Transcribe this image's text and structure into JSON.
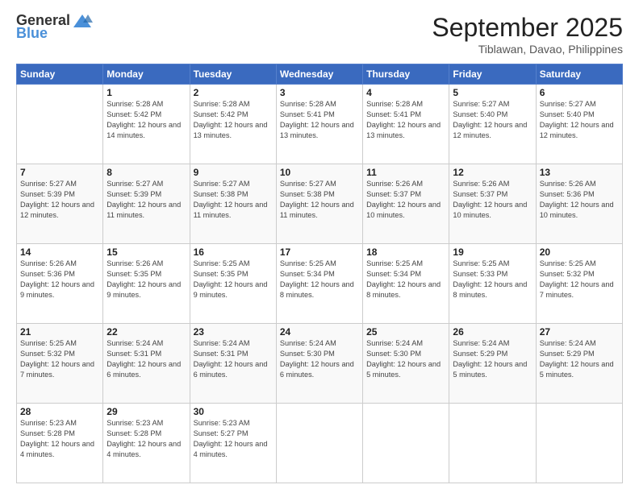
{
  "logo": {
    "general": "General",
    "blue": "Blue"
  },
  "title": "September 2025",
  "location": "Tiblawan, Davao, Philippines",
  "weekdays": [
    "Sunday",
    "Monday",
    "Tuesday",
    "Wednesday",
    "Thursday",
    "Friday",
    "Saturday"
  ],
  "weeks": [
    [
      {
        "day": "",
        "sunrise": "",
        "sunset": "",
        "daylight": ""
      },
      {
        "day": "1",
        "sunrise": "Sunrise: 5:28 AM",
        "sunset": "Sunset: 5:42 PM",
        "daylight": "Daylight: 12 hours and 14 minutes."
      },
      {
        "day": "2",
        "sunrise": "Sunrise: 5:28 AM",
        "sunset": "Sunset: 5:42 PM",
        "daylight": "Daylight: 12 hours and 13 minutes."
      },
      {
        "day": "3",
        "sunrise": "Sunrise: 5:28 AM",
        "sunset": "Sunset: 5:41 PM",
        "daylight": "Daylight: 12 hours and 13 minutes."
      },
      {
        "day": "4",
        "sunrise": "Sunrise: 5:28 AM",
        "sunset": "Sunset: 5:41 PM",
        "daylight": "Daylight: 12 hours and 13 minutes."
      },
      {
        "day": "5",
        "sunrise": "Sunrise: 5:27 AM",
        "sunset": "Sunset: 5:40 PM",
        "daylight": "Daylight: 12 hours and 12 minutes."
      },
      {
        "day": "6",
        "sunrise": "Sunrise: 5:27 AM",
        "sunset": "Sunset: 5:40 PM",
        "daylight": "Daylight: 12 hours and 12 minutes."
      }
    ],
    [
      {
        "day": "7",
        "sunrise": "Sunrise: 5:27 AM",
        "sunset": "Sunset: 5:39 PM",
        "daylight": "Daylight: 12 hours and 12 minutes."
      },
      {
        "day": "8",
        "sunrise": "Sunrise: 5:27 AM",
        "sunset": "Sunset: 5:39 PM",
        "daylight": "Daylight: 12 hours and 11 minutes."
      },
      {
        "day": "9",
        "sunrise": "Sunrise: 5:27 AM",
        "sunset": "Sunset: 5:38 PM",
        "daylight": "Daylight: 12 hours and 11 minutes."
      },
      {
        "day": "10",
        "sunrise": "Sunrise: 5:27 AM",
        "sunset": "Sunset: 5:38 PM",
        "daylight": "Daylight: 12 hours and 11 minutes."
      },
      {
        "day": "11",
        "sunrise": "Sunrise: 5:26 AM",
        "sunset": "Sunset: 5:37 PM",
        "daylight": "Daylight: 12 hours and 10 minutes."
      },
      {
        "day": "12",
        "sunrise": "Sunrise: 5:26 AM",
        "sunset": "Sunset: 5:37 PM",
        "daylight": "Daylight: 12 hours and 10 minutes."
      },
      {
        "day": "13",
        "sunrise": "Sunrise: 5:26 AM",
        "sunset": "Sunset: 5:36 PM",
        "daylight": "Daylight: 12 hours and 10 minutes."
      }
    ],
    [
      {
        "day": "14",
        "sunrise": "Sunrise: 5:26 AM",
        "sunset": "Sunset: 5:36 PM",
        "daylight": "Daylight: 12 hours and 9 minutes."
      },
      {
        "day": "15",
        "sunrise": "Sunrise: 5:26 AM",
        "sunset": "Sunset: 5:35 PM",
        "daylight": "Daylight: 12 hours and 9 minutes."
      },
      {
        "day": "16",
        "sunrise": "Sunrise: 5:25 AM",
        "sunset": "Sunset: 5:35 PM",
        "daylight": "Daylight: 12 hours and 9 minutes."
      },
      {
        "day": "17",
        "sunrise": "Sunrise: 5:25 AM",
        "sunset": "Sunset: 5:34 PM",
        "daylight": "Daylight: 12 hours and 8 minutes."
      },
      {
        "day": "18",
        "sunrise": "Sunrise: 5:25 AM",
        "sunset": "Sunset: 5:34 PM",
        "daylight": "Daylight: 12 hours and 8 minutes."
      },
      {
        "day": "19",
        "sunrise": "Sunrise: 5:25 AM",
        "sunset": "Sunset: 5:33 PM",
        "daylight": "Daylight: 12 hours and 8 minutes."
      },
      {
        "day": "20",
        "sunrise": "Sunrise: 5:25 AM",
        "sunset": "Sunset: 5:32 PM",
        "daylight": "Daylight: 12 hours and 7 minutes."
      }
    ],
    [
      {
        "day": "21",
        "sunrise": "Sunrise: 5:25 AM",
        "sunset": "Sunset: 5:32 PM",
        "daylight": "Daylight: 12 hours and 7 minutes."
      },
      {
        "day": "22",
        "sunrise": "Sunrise: 5:24 AM",
        "sunset": "Sunset: 5:31 PM",
        "daylight": "Daylight: 12 hours and 6 minutes."
      },
      {
        "day": "23",
        "sunrise": "Sunrise: 5:24 AM",
        "sunset": "Sunset: 5:31 PM",
        "daylight": "Daylight: 12 hours and 6 minutes."
      },
      {
        "day": "24",
        "sunrise": "Sunrise: 5:24 AM",
        "sunset": "Sunset: 5:30 PM",
        "daylight": "Daylight: 12 hours and 6 minutes."
      },
      {
        "day": "25",
        "sunrise": "Sunrise: 5:24 AM",
        "sunset": "Sunset: 5:30 PM",
        "daylight": "Daylight: 12 hours and 5 minutes."
      },
      {
        "day": "26",
        "sunrise": "Sunrise: 5:24 AM",
        "sunset": "Sunset: 5:29 PM",
        "daylight": "Daylight: 12 hours and 5 minutes."
      },
      {
        "day": "27",
        "sunrise": "Sunrise: 5:24 AM",
        "sunset": "Sunset: 5:29 PM",
        "daylight": "Daylight: 12 hours and 5 minutes."
      }
    ],
    [
      {
        "day": "28",
        "sunrise": "Sunrise: 5:23 AM",
        "sunset": "Sunset: 5:28 PM",
        "daylight": "Daylight: 12 hours and 4 minutes."
      },
      {
        "day": "29",
        "sunrise": "Sunrise: 5:23 AM",
        "sunset": "Sunset: 5:28 PM",
        "daylight": "Daylight: 12 hours and 4 minutes."
      },
      {
        "day": "30",
        "sunrise": "Sunrise: 5:23 AM",
        "sunset": "Sunset: 5:27 PM",
        "daylight": "Daylight: 12 hours and 4 minutes."
      },
      {
        "day": "",
        "sunrise": "",
        "sunset": "",
        "daylight": ""
      },
      {
        "day": "",
        "sunrise": "",
        "sunset": "",
        "daylight": ""
      },
      {
        "day": "",
        "sunrise": "",
        "sunset": "",
        "daylight": ""
      },
      {
        "day": "",
        "sunrise": "",
        "sunset": "",
        "daylight": ""
      }
    ]
  ]
}
